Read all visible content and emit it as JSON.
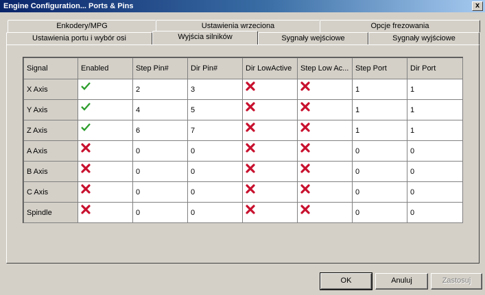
{
  "window": {
    "title": "Engine Configuration... Ports & Pins",
    "close_glyph": "x"
  },
  "tabs": {
    "row_top": [
      "Enkodery/MPG",
      "Ustawienia wrzeciona",
      "Opcje frezowania"
    ],
    "row_bottom": [
      "Ustawienia portu i wybór osi",
      "Wyjścia silników",
      "Sygnały wejściowe",
      "Sygnały wyjściowe"
    ],
    "active": "Wyjścia silników"
  },
  "grid": {
    "columns": [
      "Signal",
      "Enabled",
      "Step Pin#",
      "Dir Pin#",
      "Dir LowActive",
      "Step Low Ac...",
      "Step Port",
      "Dir Port"
    ],
    "rows": [
      {
        "signal": "X Axis",
        "enabled": "check",
        "step_pin": "2",
        "dir_pin": "3",
        "dir_low": "cross",
        "step_low": "cross",
        "step_port": "1",
        "dir_port": "1"
      },
      {
        "signal": "Y Axis",
        "enabled": "check",
        "step_pin": "4",
        "dir_pin": "5",
        "dir_low": "cross",
        "step_low": "cross",
        "step_port": "1",
        "dir_port": "1"
      },
      {
        "signal": "Z Axis",
        "enabled": "check",
        "step_pin": "6",
        "dir_pin": "7",
        "dir_low": "cross",
        "step_low": "cross",
        "step_port": "1",
        "dir_port": "1"
      },
      {
        "signal": "A Axis",
        "enabled": "cross",
        "step_pin": "0",
        "dir_pin": "0",
        "dir_low": "cross",
        "step_low": "cross",
        "step_port": "0",
        "dir_port": "0"
      },
      {
        "signal": "B Axis",
        "enabled": "cross",
        "step_pin": "0",
        "dir_pin": "0",
        "dir_low": "cross",
        "step_low": "cross",
        "step_port": "0",
        "dir_port": "0"
      },
      {
        "signal": "C Axis",
        "enabled": "cross",
        "step_pin": "0",
        "dir_pin": "0",
        "dir_low": "cross",
        "step_low": "cross",
        "step_port": "0",
        "dir_port": "0"
      },
      {
        "signal": "Spindle",
        "enabled": "cross",
        "step_pin": "0",
        "dir_pin": "0",
        "dir_low": "cross",
        "step_low": "cross",
        "step_port": "0",
        "dir_port": "0"
      }
    ]
  },
  "buttons": {
    "ok": "OK",
    "cancel": "Anuluj",
    "apply": "Zastosuj"
  },
  "icons": {
    "check": "check-icon",
    "cross": "cross-icon"
  },
  "colors": {
    "title_start": "#0a246a",
    "title_end": "#a6caf0",
    "check": "#2e9e2e",
    "cross": "#c8102e"
  }
}
